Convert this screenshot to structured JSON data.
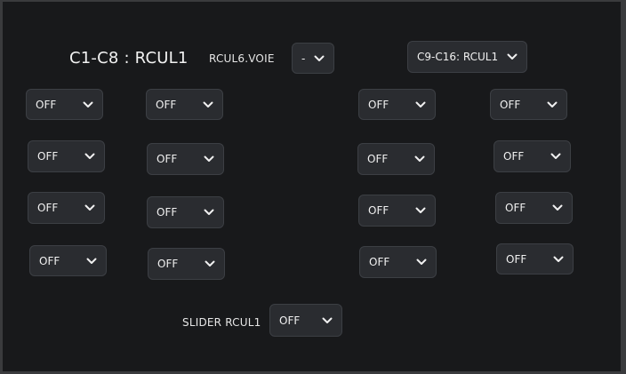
{
  "header": {
    "title": "C1-C8 : RCUL1",
    "voie_label": "RCUL6.VOIE",
    "voie_value": "-",
    "bank_select_value": "C9-C16: RCUL1"
  },
  "grid": {
    "col1": [
      "OFF",
      "OFF",
      "OFF",
      "OFF"
    ],
    "col2": [
      "OFF",
      "OFF",
      "OFF",
      "OFF"
    ],
    "col3": [
      "OFF",
      "OFF",
      "OFF",
      "OFF"
    ],
    "col4": [
      "OFF",
      "OFF",
      "OFF",
      "OFF"
    ]
  },
  "footer": {
    "slider_label": "SLIDER RCUL1",
    "slider_value": "OFF"
  },
  "icons": {
    "dropdown": "chevron-down-icon"
  }
}
